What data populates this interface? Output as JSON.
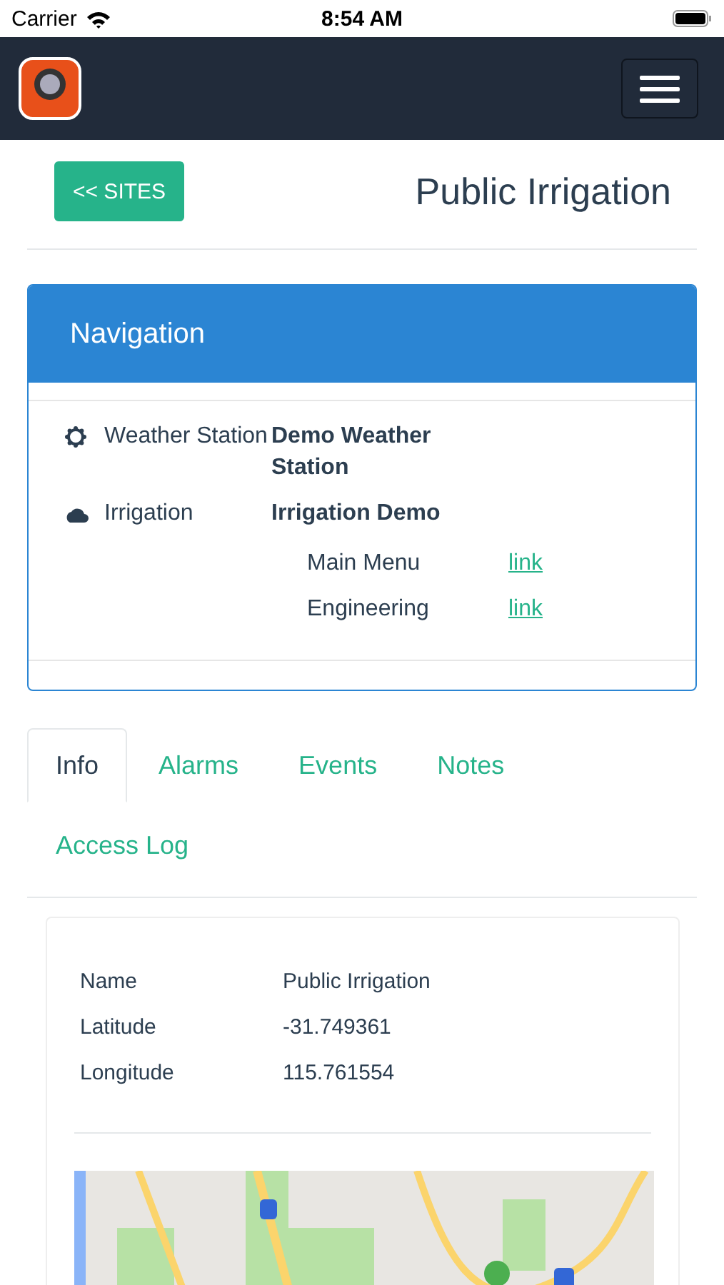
{
  "status_bar": {
    "carrier": "Carrier",
    "time": "8:54 AM"
  },
  "header": {
    "back_button": "<< SITES",
    "title": "Public Irrigation"
  },
  "navigation": {
    "title": "Navigation",
    "sites": [
      {
        "kind": "weather",
        "label": "Weather Station",
        "name": "Demo Weather Station"
      },
      {
        "kind": "irrigation",
        "label": "Irrigation",
        "name": "Irrigation Demo",
        "links": [
          {
            "label": "Main Menu",
            "link": "link"
          },
          {
            "label": "Engineering",
            "link": "link"
          }
        ]
      }
    ]
  },
  "tabs": [
    {
      "label": "Info",
      "selected": true
    },
    {
      "label": "Alarms",
      "selected": false
    },
    {
      "label": "Events",
      "selected": false
    },
    {
      "label": "Notes",
      "selected": false
    },
    {
      "label": "Access Log",
      "selected": false
    }
  ],
  "info": {
    "fields": [
      {
        "label": "Name",
        "value": "Public Irrigation"
      },
      {
        "label": "Latitude",
        "value": "-31.749361"
      },
      {
        "label": "Longitude",
        "value": "115.761554"
      }
    ]
  }
}
